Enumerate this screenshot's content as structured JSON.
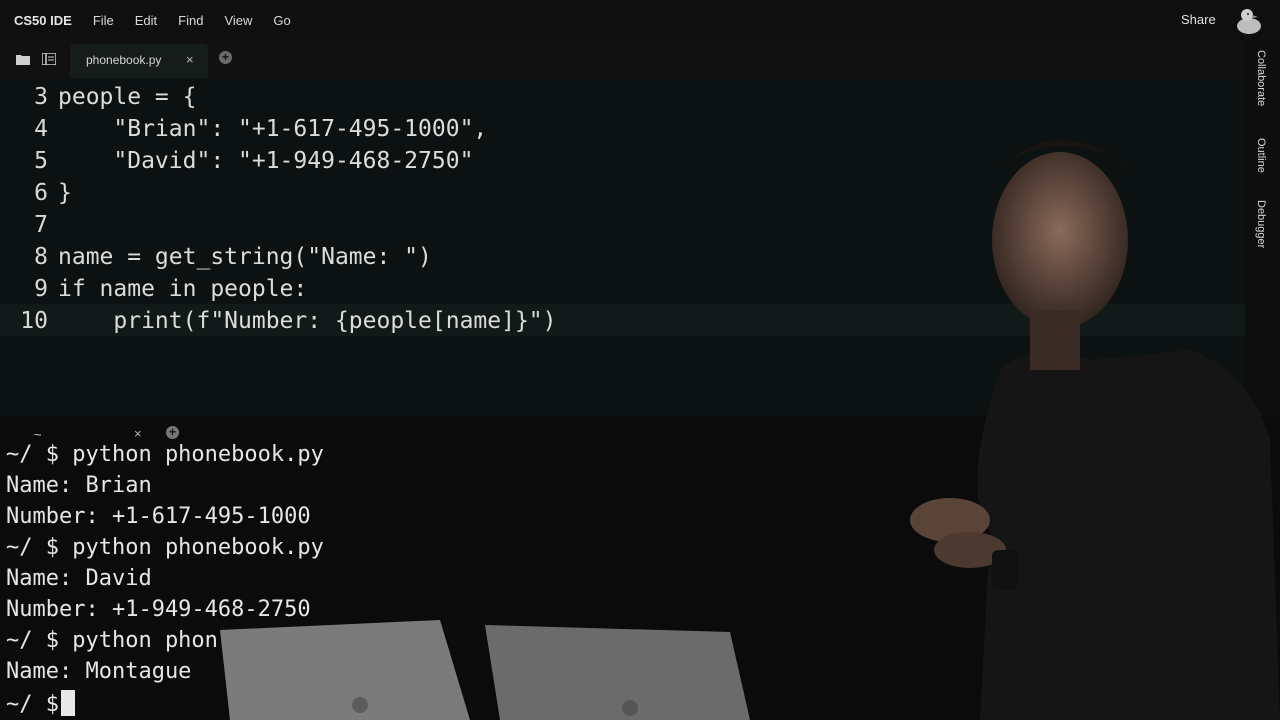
{
  "menubar": {
    "brand": "CS50 IDE",
    "items": [
      "File",
      "Edit",
      "Find",
      "View",
      "Go"
    ],
    "share": "Share",
    "duck_icon": "duck-icon"
  },
  "tabs": {
    "folder_icon": "folder-icon",
    "tree_icon": "tree-icon",
    "active_tab": "phonebook.py",
    "close": "×",
    "add": "+"
  },
  "editor": {
    "lines": [
      {
        "num": "3",
        "code": "people = {"
      },
      {
        "num": "4",
        "code": "    \"Brian\": \"+1-617-495-1000\","
      },
      {
        "num": "5",
        "code": "    \"David\": \"+1-949-468-2750\""
      },
      {
        "num": "6",
        "code": "}"
      },
      {
        "num": "7",
        "code": ""
      },
      {
        "num": "8",
        "code": "name = get_string(\"Name: \")"
      },
      {
        "num": "9",
        "code": "if name in people:"
      },
      {
        "num": "10",
        "code": "    print(f\"Number: {people[name]}\")"
      }
    ]
  },
  "side_panel": {
    "collaborate": "Collaborate",
    "outline": "Outline",
    "debugger": "Debugger"
  },
  "terminal_tab": {
    "label": "~",
    "close": "×",
    "add": "+"
  },
  "terminal": {
    "lines": [
      "~/ $ python phonebook.py",
      "Name: Brian",
      "Number: +1-617-495-1000",
      "~/ $ python phonebook.py",
      "Name: David",
      "Number: +1-949-468-2750",
      "~/ $ python phon",
      "Name: Montague",
      "~/ $"
    ]
  },
  "colors": {
    "editor_bg": "#0c1211",
    "terminal_bg": "#0b0b0b",
    "text": "#dcdcdc"
  }
}
